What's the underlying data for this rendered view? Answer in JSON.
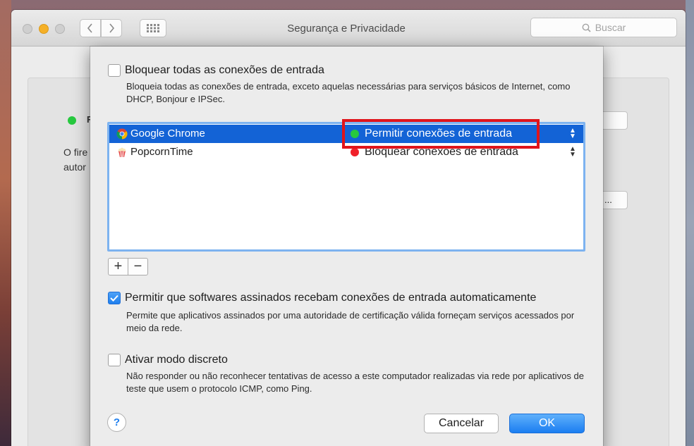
{
  "window": {
    "title": "Segurança e Privacidade",
    "search_placeholder": "Buscar"
  },
  "background": {
    "partial_label": "F",
    "partial_text_line1": "O fire",
    "partial_text_line2": "autor",
    "partial_button": "..."
  },
  "sheet": {
    "block_all": {
      "label": "Bloquear todas as conexões de entrada",
      "checked": false,
      "description": "Bloqueia todas as conexões de entrada, exceto aquelas necessárias para serviços básicos de Internet, como DHCP, Bonjour e IPSec."
    },
    "apps": [
      {
        "name": "Google Chrome",
        "status": "Permitir conexões de entrada",
        "status_color": "#27c93f",
        "selected": true,
        "icon": "chrome-icon"
      },
      {
        "name": "PopcornTime",
        "status": "Bloquear conexões de entrada",
        "status_color": "#f0202a",
        "selected": false,
        "icon": "popcorn-icon"
      }
    ],
    "add_label": "+",
    "remove_label": "−",
    "signed_software": {
      "label": "Permitir que softwares assinados recebam conexões de entrada automaticamente",
      "checked": true,
      "description": "Permite que aplicativos assinados por uma autoridade de certificação válida forneçam serviços acessados por meio da rede."
    },
    "stealth_mode": {
      "label": "Ativar modo discreto",
      "checked": false,
      "description": "Não responder ou não reconhecer tentativas de acesso a este computador realizadas via rede por aplicativos de teste que usem o protocolo ICMP, como Ping."
    },
    "help_label": "?",
    "cancel_label": "Cancelar",
    "ok_label": "OK",
    "accent_color": "#1f7fee",
    "highlight_color": "#e0141b"
  }
}
